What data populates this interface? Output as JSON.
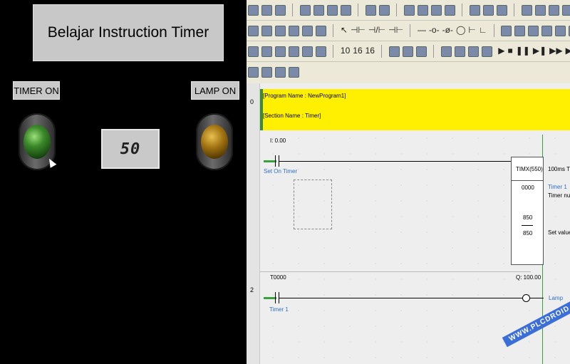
{
  "hmi": {
    "title": "Belajar Instruction Timer",
    "timer_label": "TIMER ON",
    "lamp_label": "LAMP ON",
    "display_value": "50"
  },
  "ide": {
    "rungs": [
      {
        "number": "0"
      },
      {
        "number": "2"
      }
    ],
    "comment": {
      "program_name": "[Program Name : NewProgram1]",
      "section_name": "[Section Name : Timer]"
    },
    "rung0": {
      "contact_addr": "I: 0.00",
      "contact_comment": "Set On Timer",
      "timer_instr": "TIMX(550)",
      "timer_num": "0000",
      "set_val": "850",
      "set_val2": "850",
      "right_comment1": "100ms Ti",
      "right_comment2": "Timer 1",
      "right_comment3": "Timer nur",
      "right_comment4": "Set value"
    },
    "rung2": {
      "contact_addr": "T0000",
      "contact_comment": "Timer 1",
      "coil_addr": "Q: 100.00",
      "coil_comment": "Lamp"
    }
  },
  "watermark": "WWW.PLCDROID.COM",
  "colors": {
    "comment_bg": "#ffef00",
    "active_green": "#3aa23a",
    "label_blue": "#2b6fc9"
  }
}
